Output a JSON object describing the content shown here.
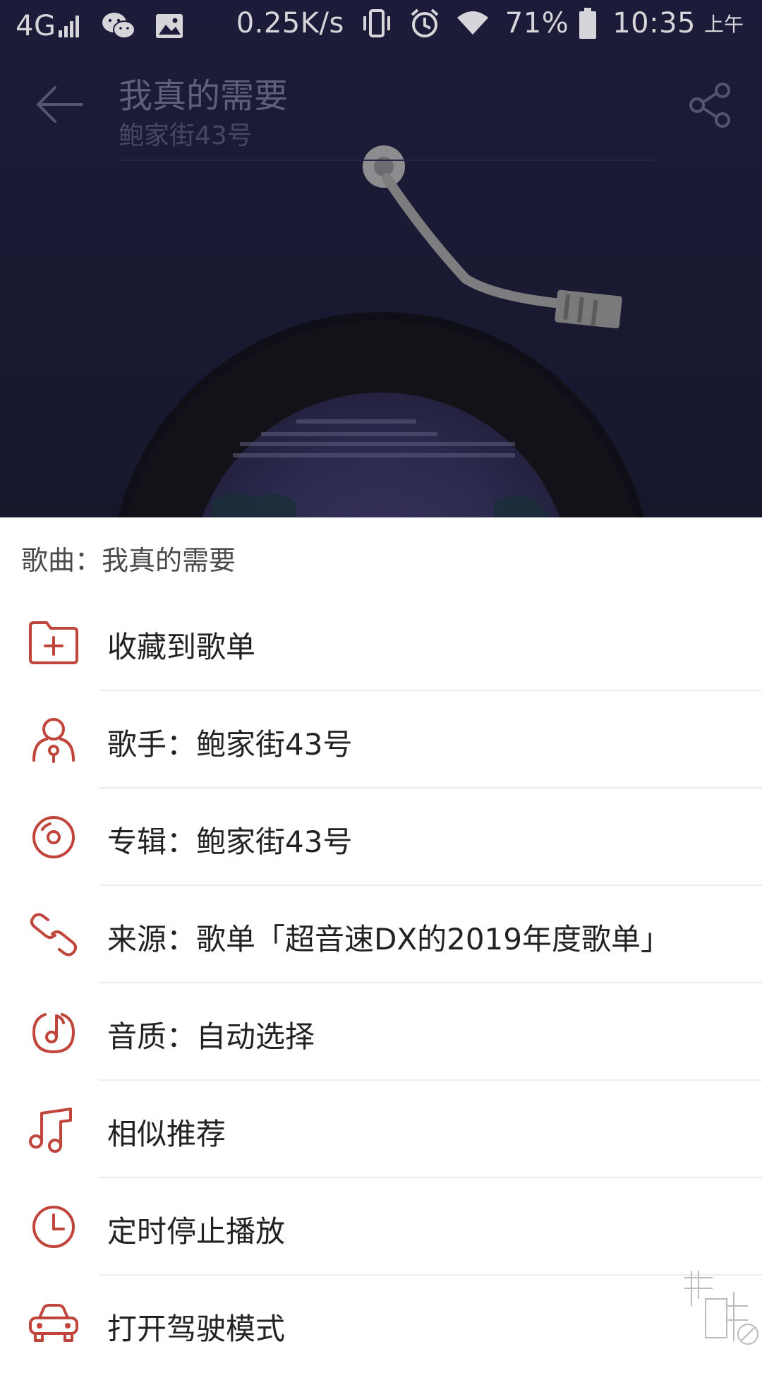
{
  "status_bar": {
    "network": "4G",
    "speed": "0.25K/s",
    "battery": "71%",
    "time": "10:35",
    "ampm": "上午"
  },
  "player": {
    "title": "我真的需要",
    "artist": "鲍家街43号"
  },
  "sheet": {
    "song_prefix": "歌曲：",
    "song_name": "我真的需要",
    "items": [
      {
        "icon": "folder-plus-icon",
        "label": "收藏到歌单"
      },
      {
        "icon": "singer-icon",
        "label": "歌手：鲍家街43号"
      },
      {
        "icon": "album-disc-icon",
        "label": "专辑：鲍家街43号"
      },
      {
        "icon": "link-icon",
        "label": "来源：歌单「超音速DX的2019年度歌单」"
      },
      {
        "icon": "quality-note-icon",
        "label": "音质：自动选择"
      },
      {
        "icon": "music-notes-icon",
        "label": "相似推荐"
      },
      {
        "icon": "clock-icon",
        "label": "定时停止播放"
      },
      {
        "icon": "car-icon",
        "label": "打开驾驶模式"
      }
    ]
  },
  "colors": {
    "accent": "#c0453a",
    "player_bg": "#1c1c3a"
  }
}
